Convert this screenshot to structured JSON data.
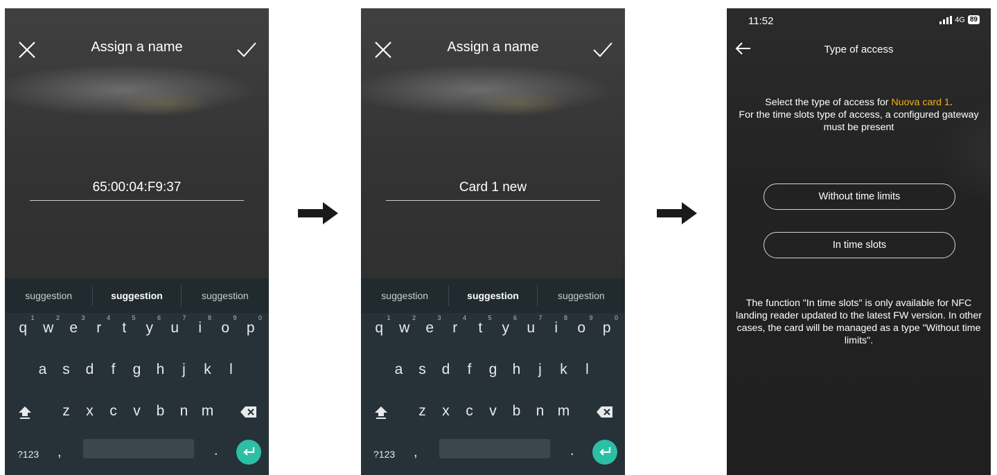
{
  "screen1": {
    "title": "Assign a name",
    "name_value": "65:00:04:F9:37",
    "close_icon": "close-icon",
    "confirm_icon": "check-icon"
  },
  "screen2": {
    "title": "Assign a name",
    "name_value": "Card 1 new",
    "close_icon": "close-icon",
    "confirm_icon": "check-icon"
  },
  "keyboard": {
    "suggestions": [
      "suggestion",
      "suggestion",
      "suggestion"
    ],
    "row1": [
      {
        "key": "q",
        "hint": "1"
      },
      {
        "key": "w",
        "hint": "2"
      },
      {
        "key": "e",
        "hint": "3"
      },
      {
        "key": "r",
        "hint": "4"
      },
      {
        "key": "t",
        "hint": "5"
      },
      {
        "key": "y",
        "hint": "6"
      },
      {
        "key": "u",
        "hint": "7"
      },
      {
        "key": "i",
        "hint": "8"
      },
      {
        "key": "o",
        "hint": "9"
      },
      {
        "key": "p",
        "hint": "0"
      }
    ],
    "row2": [
      "a",
      "s",
      "d",
      "f",
      "g",
      "h",
      "j",
      "k",
      "l"
    ],
    "row3": [
      "z",
      "x",
      "c",
      "v",
      "b",
      "n",
      "m"
    ],
    "symbols_label": "?123",
    "comma_label": ",",
    "period_label": ".",
    "shift_icon": "shift-icon",
    "backspace_icon": "backspace-icon",
    "enter_icon": "enter-icon",
    "accent_color": "#2bbfa5"
  },
  "flow_arrow_icon": "arrow-right-icon",
  "screen3": {
    "status_time": "11:52",
    "network": "4G",
    "battery": "89",
    "title": "Type of access",
    "intro_prefix": "Select the type of access for ",
    "intro_highlight": "Nuova card 1",
    "intro_suffix": ".",
    "intro_line2": "For the time slots type of access, a configured gateway must be present",
    "option1": "Without time limits",
    "option2": "In time slots",
    "note": "The function \"In time slots\" is only available for NFC landing reader updated to the latest FW version. In other cases, the card will be managed as a type \"Without time limits\".",
    "highlight_color": "#f3b00f"
  }
}
